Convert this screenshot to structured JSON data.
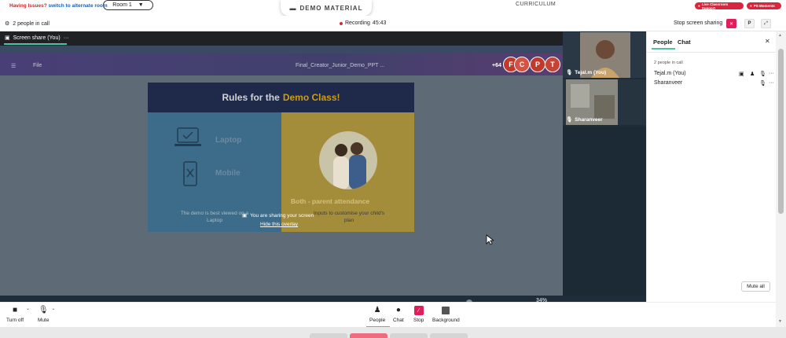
{
  "topbar": {
    "issues_text": "Having Issues?",
    "issues_link": "switch to alternate room",
    "room_label": "Room 1",
    "demo_material": "DEMO MATERIAL",
    "curriculum": "CURRICULUM",
    "live_support": "Live Classroom Support",
    "ps_moments": "PS Moments"
  },
  "call": {
    "people_count": "2 people in call",
    "recording_label": "Recording",
    "recording_time": "45:43",
    "stop_sharing": "Stop screen sharing",
    "p_button": "P"
  },
  "stage": {
    "share_tab": "Screen share (You)",
    "share_dots": "···",
    "ppt_file": "File",
    "ppt_title": "Final_Creator_Junior_Demo_PPT ...",
    "ppt_count": "+64",
    "avatars": [
      "F",
      "C",
      "P",
      "T"
    ],
    "slide": {
      "title_a": "Rules for the",
      "title_b": "Demo Class!",
      "laptop": "Laptop",
      "mobile": "Mobile",
      "note": "The demo is best viewed on a Laptop",
      "right_title": "Both - parent attendance",
      "right_sub": "Inputs to customise your child's plan"
    },
    "overlay_msg": "You are sharing your screen",
    "overlay_link": "Hide this overlay",
    "zoom": "34%"
  },
  "tiles": [
    {
      "name": "Tejal.m (You)"
    },
    {
      "name": "Sharanveer"
    }
  ],
  "panel": {
    "tab_people": "People",
    "tab_chat": "Chat",
    "in_call": "2 people in call",
    "participants": [
      {
        "name": "Tejal.m (You)"
      },
      {
        "name": "Sharanveer"
      }
    ],
    "mute_all": "Mute all"
  },
  "bottom": {
    "turn_off": "Turn off",
    "mute": "Mute",
    "people": "People",
    "chat": "Chat",
    "stop": "Stop",
    "background": "Background"
  },
  "colors": {
    "accent_green": "#4fc3a1",
    "alert_red": "#e01e5a",
    "stage_dark": "#1f2d3a"
  }
}
